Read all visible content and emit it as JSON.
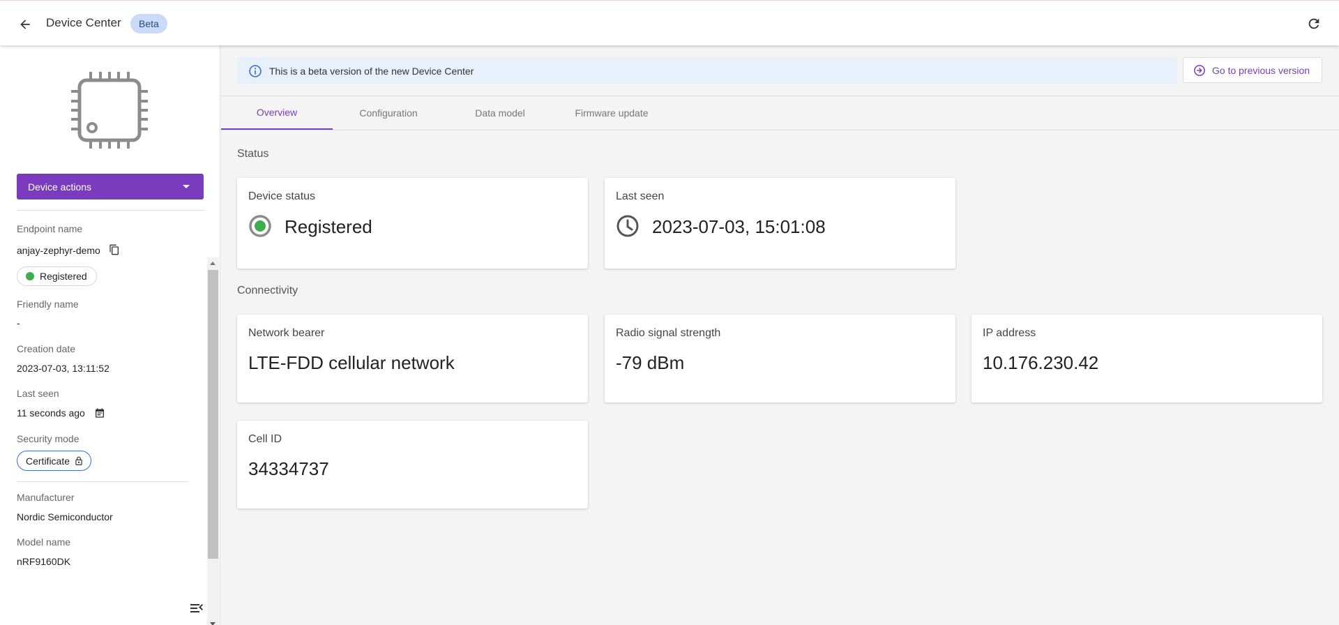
{
  "header": {
    "title": "Device Center",
    "badge": "Beta"
  },
  "sidebar": {
    "actions_label": "Device actions",
    "endpoint_name_label": "Endpoint name",
    "endpoint_name": "anjay-zephyr-demo",
    "status_chip": "Registered",
    "friendly_name_label": "Friendly name",
    "friendly_name": "-",
    "creation_date_label": "Creation date",
    "creation_date": "2023-07-03, 13:11:52",
    "last_seen_label": "Last seen",
    "last_seen": "11 seconds ago",
    "security_mode_label": "Security mode",
    "security_mode": "Certificate",
    "manufacturer_label": "Manufacturer",
    "manufacturer": "Nordic Semiconductor",
    "model_name_label": "Model name",
    "model_name": "nRF9160DK"
  },
  "banner": {
    "text": "This is a beta version of the new Device Center",
    "prev_version_label": "Go to previous version"
  },
  "tabs": [
    {
      "label": "Overview",
      "active": true
    },
    {
      "label": "Configuration",
      "active": false
    },
    {
      "label": "Data model",
      "active": false
    },
    {
      "label": "Firmware update",
      "active": false
    }
  ],
  "status_section": {
    "title": "Status",
    "device_status_label": "Device status",
    "device_status_value": "Registered",
    "last_seen_label": "Last seen",
    "last_seen_value": "2023-07-03, 15:01:08"
  },
  "connectivity_section": {
    "title": "Connectivity",
    "network_bearer_label": "Network bearer",
    "network_bearer_value": "LTE-FDD cellular network",
    "radio_signal_label": "Radio signal strength",
    "radio_signal_value": "-79 dBm",
    "ip_address_label": "IP address",
    "ip_address_value": "10.176.230.42",
    "cell_id_label": "Cell ID",
    "cell_id_value": "34334737"
  },
  "colors": {
    "accent": "#7b3bbf",
    "status_green": "#3eae4a",
    "beta_chip": "#c9dbf6",
    "banner_bg": "#e8f1fb"
  },
  "icons": [
    "back-arrow-icon",
    "refresh-icon",
    "chip-icon",
    "copy-icon",
    "calendar-icon",
    "lock-icon",
    "info-icon",
    "arrow-circle-icon",
    "clock-icon",
    "collapse-menu-icon"
  ]
}
